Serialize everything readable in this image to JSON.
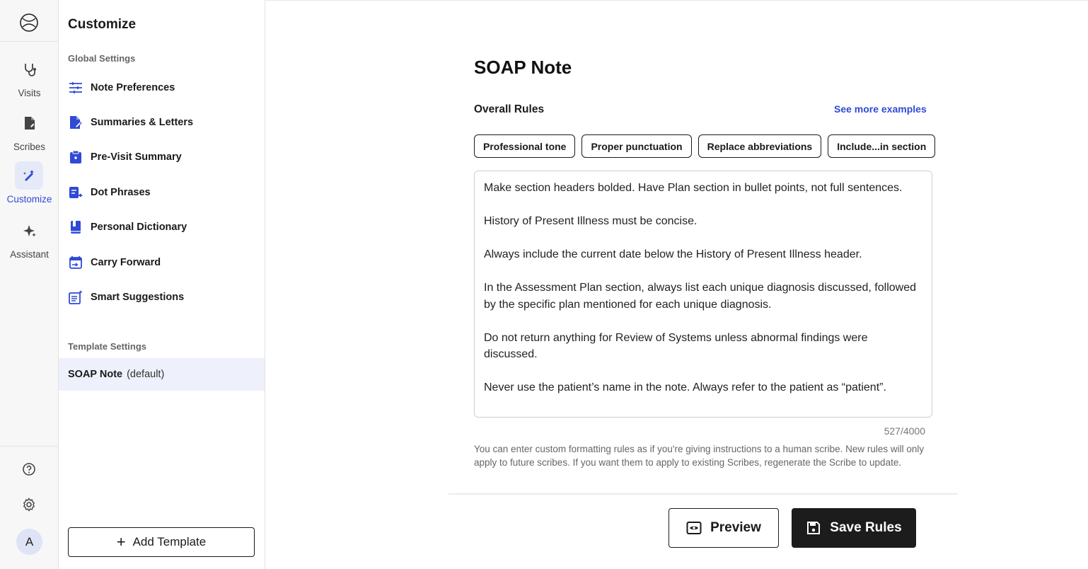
{
  "rail": {
    "items": [
      {
        "label": "Visits",
        "icon": "stethoscope-icon"
      },
      {
        "label": "Scribes",
        "icon": "file-edit-icon"
      },
      {
        "label": "Customize",
        "icon": "wand-icon"
      },
      {
        "label": "Assistant",
        "icon": "sparkle-icon"
      }
    ],
    "avatar_initial": "A"
  },
  "panel": {
    "title": "Customize",
    "global_label": "Global Settings",
    "items": [
      {
        "label": "Note Preferences"
      },
      {
        "label": "Summaries & Letters"
      },
      {
        "label": "Pre-Visit Summary"
      },
      {
        "label": "Dot Phrases"
      },
      {
        "label": "Personal Dictionary"
      },
      {
        "label": "Carry Forward"
      },
      {
        "label": "Smart Suggestions"
      }
    ],
    "template_label": "Template Settings",
    "template": {
      "name": "SOAP Note",
      "suffix": "(default)"
    },
    "add_template": "Add Template"
  },
  "main": {
    "title": "SOAP Note",
    "rules_label": "Overall Rules",
    "see_more": "See more examples",
    "chips": [
      "Professional tone",
      "Proper punctuation",
      "Replace abbreviations",
      "Include...in section"
    ],
    "rules": [
      "Make section headers bolded. Have Plan section in bullet points, not full sentences.",
      "History of Present Illness must be concise.",
      "Always include the current date below the History of Present Illness header.",
      "In the Assessment  Plan section, always list each unique diagnosis discussed, followed by the specific plan mentioned for each unique diagnosis.",
      "Do not return anything for Review of Systems unless abnormal findings were discussed.",
      "Never use the patient’s name in the note. Always refer to the patient as “patient”."
    ],
    "counter": "527/4000",
    "help": "You can enter custom formatting rules as if you're giving instructions to a human scribe. New rules will only apply to future scribes. If you want them to apply to existing Scribes, regenerate the Scribe to update.",
    "preview_label": "Preview",
    "save_label": "Save Rules"
  },
  "colors": {
    "accent": "#2f4ad6",
    "active_bg": "#e6e9f8",
    "template_bg": "#eef0fb",
    "save_bg": "#1c1c1c"
  }
}
